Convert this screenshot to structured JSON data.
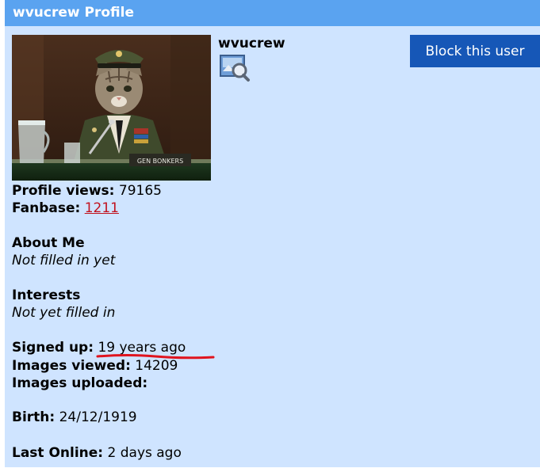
{
  "profile": {
    "title": "wvucrew Profile",
    "username": "wvucrew",
    "block_button": "Block this user",
    "avatar_plaque_text": "GEN BONKERS"
  },
  "stats": {
    "profile_views_label": "Profile views:",
    "profile_views_value": "79165",
    "fanbase_label": "Fanbase:",
    "fanbase_value": "1211",
    "signed_up_label": "Signed up:",
    "signed_up_value": "19 years ago",
    "images_viewed_label": "Images viewed:",
    "images_viewed_value": "14209",
    "images_uploaded_label": "Images uploaded:",
    "images_uploaded_value": "",
    "birth_label": "Birth:",
    "birth_value": "24/12/1919",
    "last_online_label": "Last Online:",
    "last_online_value": "2 days ago"
  },
  "about": {
    "heading": "About Me",
    "text": "Not filled in yet"
  },
  "interests": {
    "heading": "Interests",
    "text": "Not yet filled in"
  },
  "icons": {
    "gallery": "image-gallery-magnifier-icon"
  },
  "colors": {
    "title_bar": "#5aa3f0",
    "panel_bg": "#cfe4ff",
    "block_button": "#1657b7",
    "fanbase_link": "#c1121f",
    "annotation_underline": "#e0141e"
  }
}
